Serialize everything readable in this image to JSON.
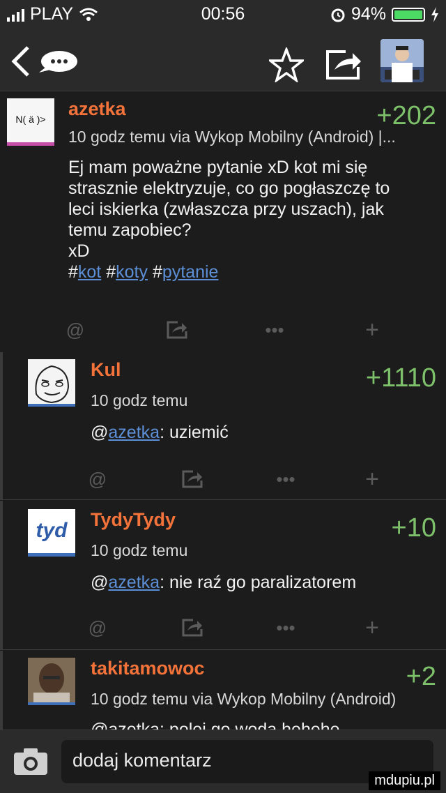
{
  "status": {
    "carrier": "PLAY",
    "time": "00:56",
    "battery": "94%"
  },
  "posts": [
    {
      "author": "azetka",
      "votes": "+202",
      "meta": "10 godz temu via Wykop Mobilny (Android) |...",
      "lines": [
        "Ej mam poważne pytanie xD kot mi się",
        "strasznie elektryzuje, co go pogłaszczę to",
        "leci iskierka (zwłaszcza przy uszach), jak",
        "temu zapobiec?",
        "xD"
      ],
      "tags": [
        "kot",
        "koty",
        "pytanie"
      ],
      "tag_prefix": "#",
      "avatar_text": "N( ä )>"
    },
    {
      "author": "Kul",
      "votes": "+1110",
      "meta": "10 godz temu",
      "mention_prefix": "@",
      "mention": "azetka",
      "text": ": uziemić"
    },
    {
      "author": "TydyTydy",
      "votes": "+10",
      "meta": "10 godz temu",
      "mention_prefix": "@",
      "mention": "azetka",
      "text": ": nie raź go paralizatorem",
      "avatar_text": "tyd"
    },
    {
      "author": "takitamowoc",
      "votes": "+2",
      "meta": "10 godz temu via Wykop Mobilny (Android)",
      "partial": "@azetka: polej go wodą hehehe"
    }
  ],
  "actions": {
    "at": "@",
    "more": "•••",
    "plus": "+"
  },
  "composer": {
    "placeholder": "dodaj komentarz"
  },
  "watermark": "mdupiu.pl",
  "colors": {
    "author": "#f3733a",
    "votes": "#7ec16b",
    "link": "#5c8fd6"
  }
}
